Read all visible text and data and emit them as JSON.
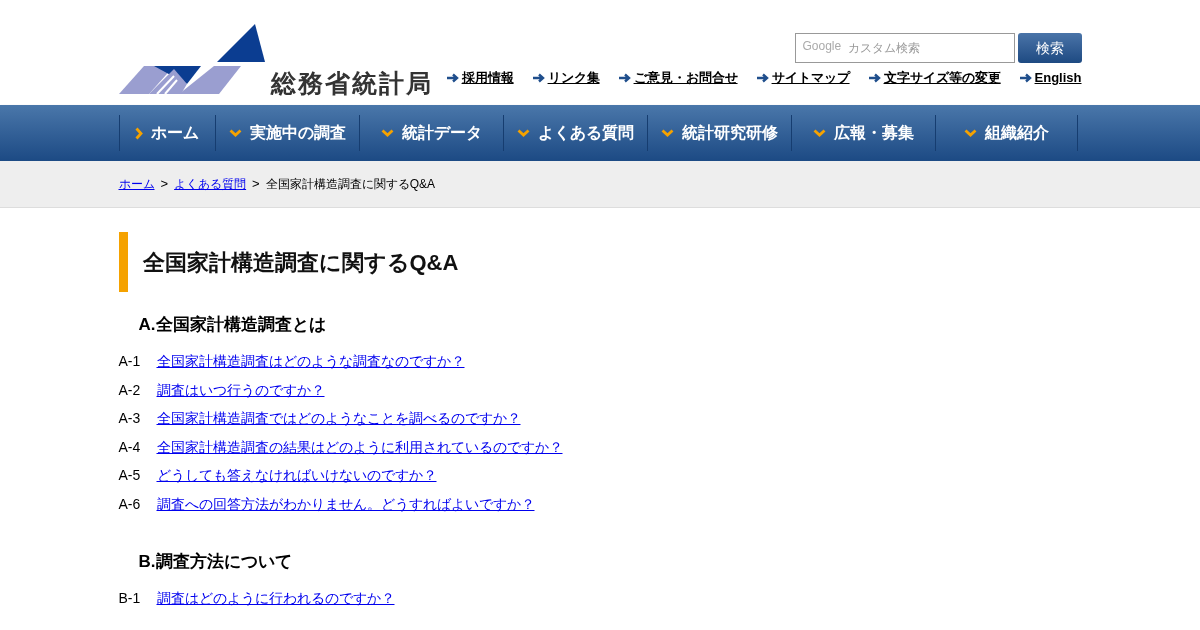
{
  "header": {
    "logo_text": "総務省統計局",
    "search": {
      "logo_text": "Google",
      "placeholder": "カスタム検索",
      "button": "検索"
    },
    "utility_links": [
      "採用情報",
      "リンク集",
      "ご意見・お問合せ",
      "サイトマップ",
      "文字サイズ等の変更",
      "English"
    ]
  },
  "nav": [
    {
      "label": "ホーム",
      "kind": "link"
    },
    {
      "label": "実施中の調査",
      "kind": "menu"
    },
    {
      "label": "統計データ",
      "kind": "menu"
    },
    {
      "label": "よくある質問",
      "kind": "menu"
    },
    {
      "label": "統計研究研修",
      "kind": "menu"
    },
    {
      "label": "広報・募集",
      "kind": "menu"
    },
    {
      "label": "組織紹介",
      "kind": "menu"
    }
  ],
  "breadcrumb_separator": ">",
  "breadcrumb": [
    {
      "label": "ホーム",
      "kind": "link"
    },
    {
      "label": "よくある質問",
      "kind": "link"
    },
    {
      "label": "全国家計構造調査に関するQ&A",
      "kind": "current"
    }
  ],
  "page_title": "全国家計構造調査に関するQ&A",
  "sections": [
    {
      "heading": "A.全国家計構造調査とは",
      "items": [
        {
          "number": "A-1",
          "question": "全国家計構造調査はどのような調査なのですか？"
        },
        {
          "number": "A-2",
          "question": "調査はいつ行うのですか？"
        },
        {
          "number": "A-3",
          "question": "全国家計構造調査ではどのようなことを調べるのですか？"
        },
        {
          "number": "A-4",
          "question": "全国家計構造調査の結果はどのように利用されているのですか？"
        },
        {
          "number": "A-5",
          "question": "どうしても答えなければいけないのですか？"
        },
        {
          "number": "A-6",
          "question": "調査への回答方法がわかりません。どうすればよいですか？"
        }
      ]
    },
    {
      "heading": "B.調査方法について",
      "items": [
        {
          "number": "B-1",
          "question": "調査はどのように行われるのですか？"
        }
      ]
    }
  ]
}
